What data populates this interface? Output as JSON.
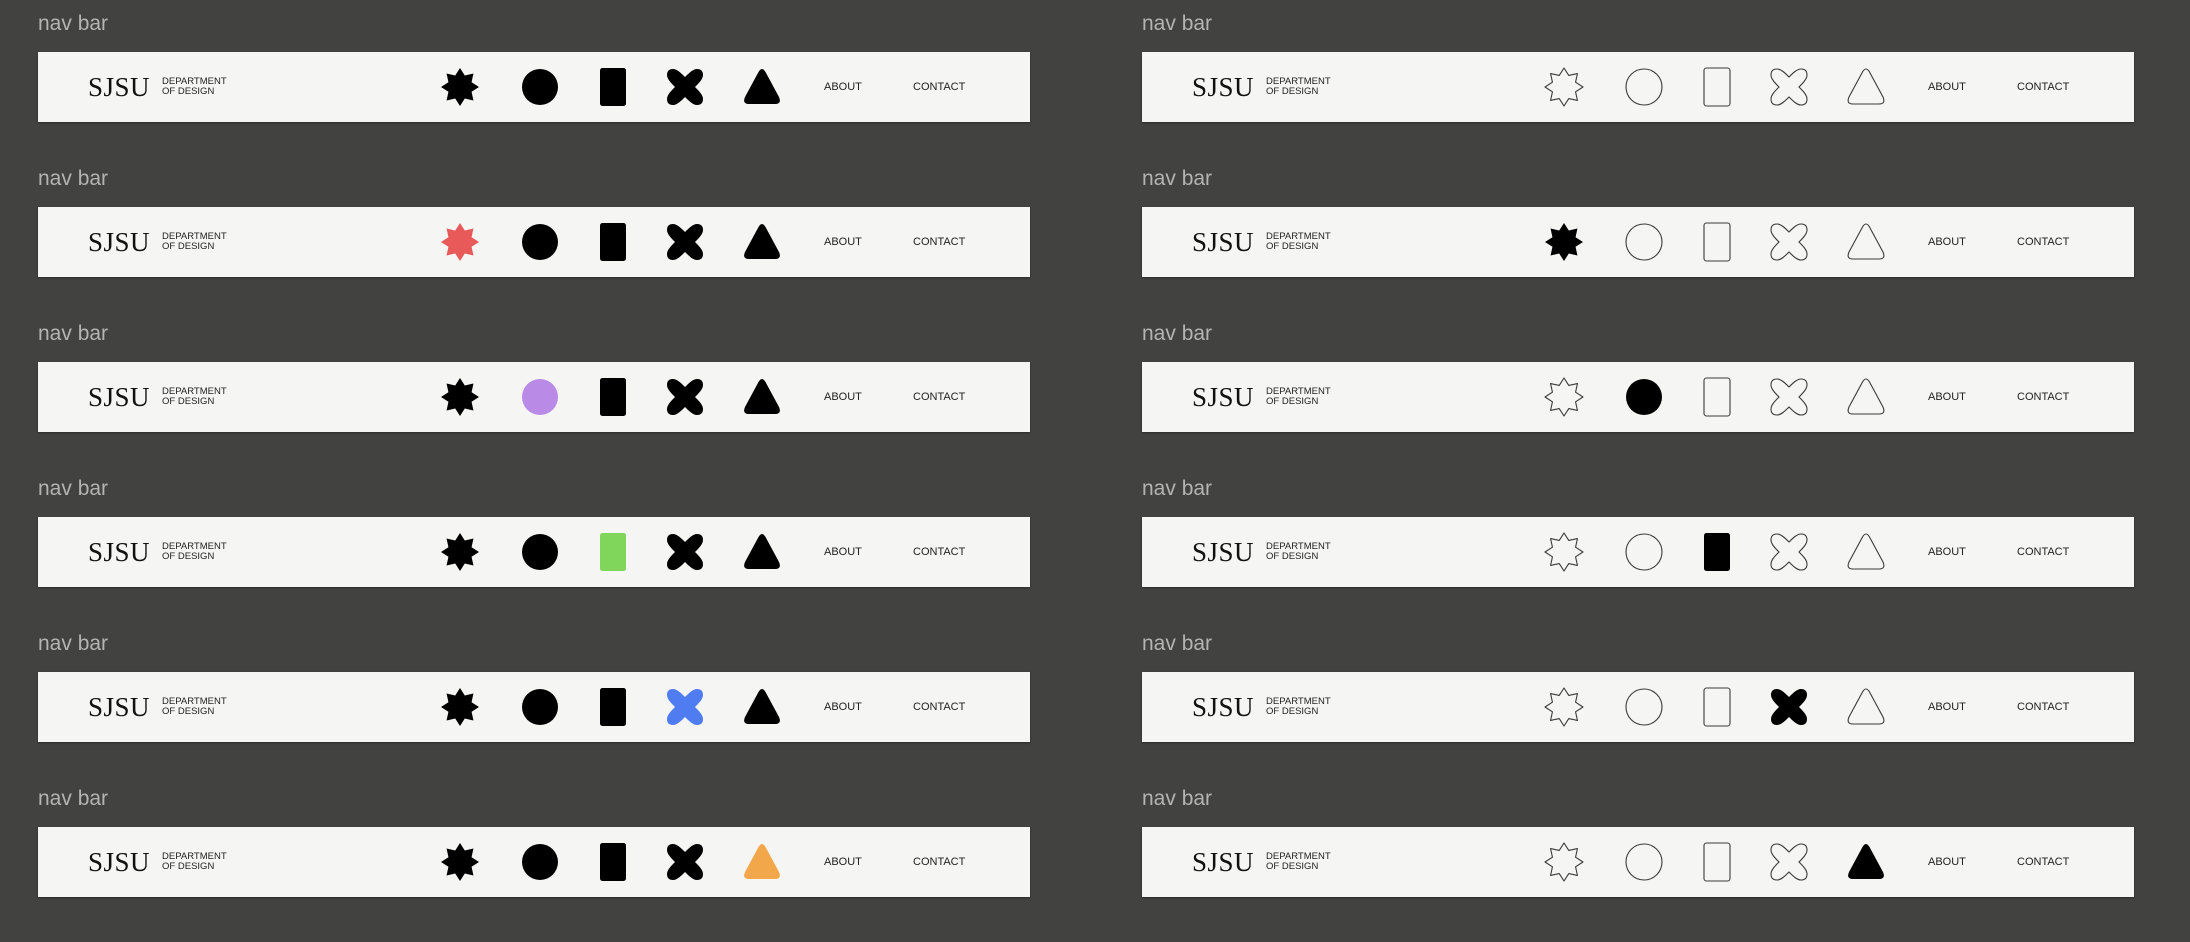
{
  "colors": {
    "background": "#424240",
    "navbar": "#f5f5f3",
    "filled": "#000000",
    "outline": "#3a3a3a",
    "accent_star": "#e85a5a",
    "accent_circle": "#b98be6",
    "accent_rect": "#7fd65a",
    "accent_cross": "#4f7cf0",
    "accent_triangle": "#f2a74b"
  },
  "icons": [
    "star-icon",
    "circle-icon",
    "rectangle-icon",
    "cross-icon",
    "triangle-icon"
  ],
  "frames": [
    {
      "label": "nav bar",
      "logo": "SJSU",
      "dept_line1": "DEPARTMENT",
      "dept_line2": "OF DESIGN",
      "about": "ABOUT",
      "contact": "CONTACT",
      "styles": [
        "#000000",
        "#000000",
        "#000000",
        "#000000",
        "#000000"
      ]
    },
    {
      "label": "nav bar",
      "logo": "SJSU",
      "dept_line1": "DEPARTMENT",
      "dept_line2": "OF DESIGN",
      "about": "ABOUT",
      "contact": "CONTACT",
      "styles": [
        "#e85a5a",
        "#000000",
        "#000000",
        "#000000",
        "#000000"
      ]
    },
    {
      "label": "nav bar",
      "logo": "SJSU",
      "dept_line1": "DEPARTMENT",
      "dept_line2": "OF DESIGN",
      "about": "ABOUT",
      "contact": "CONTACT",
      "styles": [
        "#000000",
        "#b98be6",
        "#000000",
        "#000000",
        "#000000"
      ]
    },
    {
      "label": "nav bar",
      "logo": "SJSU",
      "dept_line1": "DEPARTMENT",
      "dept_line2": "OF DESIGN",
      "about": "ABOUT",
      "contact": "CONTACT",
      "styles": [
        "#000000",
        "#000000",
        "#7fd65a",
        "#000000",
        "#000000"
      ]
    },
    {
      "label": "nav bar",
      "logo": "SJSU",
      "dept_line1": "DEPARTMENT",
      "dept_line2": "OF DESIGN",
      "about": "ABOUT",
      "contact": "CONTACT",
      "styles": [
        "#000000",
        "#000000",
        "#000000",
        "#4f7cf0",
        "#000000"
      ]
    },
    {
      "label": "nav bar",
      "logo": "SJSU",
      "dept_line1": "DEPARTMENT",
      "dept_line2": "OF DESIGN",
      "about": "ABOUT",
      "contact": "CONTACT",
      "styles": [
        "#000000",
        "#000000",
        "#000000",
        "#000000",
        "#f2a74b"
      ]
    },
    {
      "label": "nav bar",
      "logo": "SJSU",
      "dept_line1": "DEPARTMENT",
      "dept_line2": "OF DESIGN",
      "about": "ABOUT",
      "contact": "CONTACT",
      "styles": [
        "outline",
        "outline",
        "outline",
        "outline",
        "outline"
      ]
    },
    {
      "label": "nav bar",
      "logo": "SJSU",
      "dept_line1": "DEPARTMENT",
      "dept_line2": "OF DESIGN",
      "about": "ABOUT",
      "contact": "CONTACT",
      "styles": [
        "#000000",
        "outline",
        "outline",
        "outline",
        "outline"
      ]
    },
    {
      "label": "nav bar",
      "logo": "SJSU",
      "dept_line1": "DEPARTMENT",
      "dept_line2": "OF DESIGN",
      "about": "ABOUT",
      "contact": "CONTACT",
      "styles": [
        "outline",
        "#000000",
        "outline",
        "outline",
        "outline"
      ]
    },
    {
      "label": "nav bar",
      "logo": "SJSU",
      "dept_line1": "DEPARTMENT",
      "dept_line2": "OF DESIGN",
      "about": "ABOUT",
      "contact": "CONTACT",
      "styles": [
        "outline",
        "outline",
        "#000000",
        "outline",
        "outline"
      ]
    },
    {
      "label": "nav bar",
      "logo": "SJSU",
      "dept_line1": "DEPARTMENT",
      "dept_line2": "OF DESIGN",
      "about": "ABOUT",
      "contact": "CONTACT",
      "styles": [
        "outline",
        "outline",
        "outline",
        "#000000",
        "outline"
      ]
    },
    {
      "label": "nav bar",
      "logo": "SJSU",
      "dept_line1": "DEPARTMENT",
      "dept_line2": "OF DESIGN",
      "about": "ABOUT",
      "contact": "CONTACT",
      "styles": [
        "outline",
        "outline",
        "outline",
        "outline",
        "#000000"
      ]
    }
  ]
}
